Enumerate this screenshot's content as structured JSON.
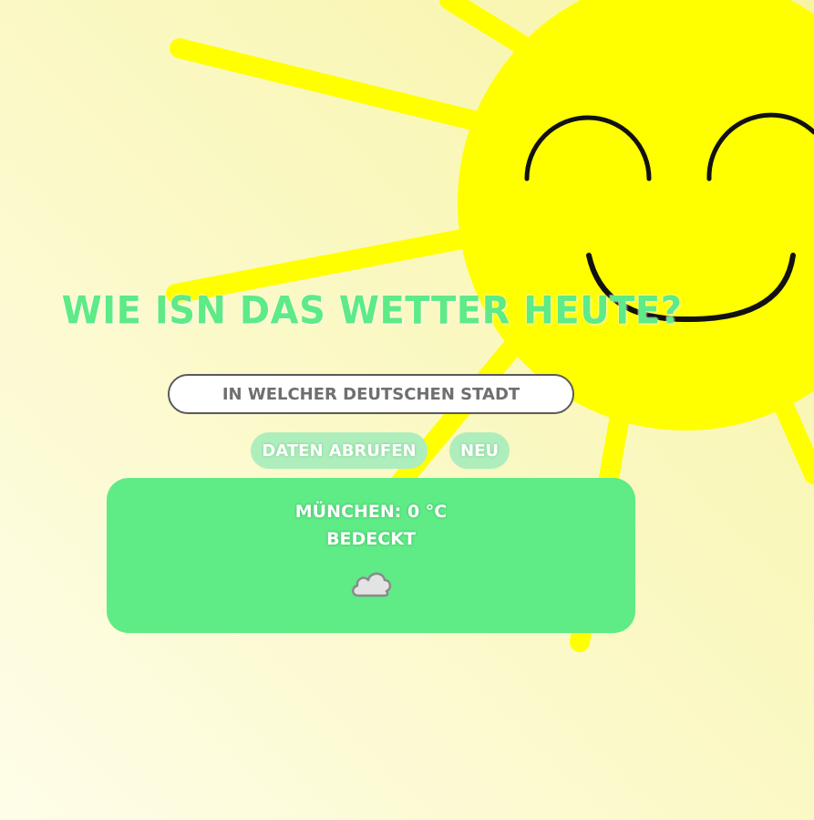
{
  "page": {
    "title": "Wie isn das Wetter heute?"
  },
  "search": {
    "placeholder": "In welcher deutschen Stadt"
  },
  "buttons": {
    "fetch_label": "Daten abrufen",
    "new_label": "Neu"
  },
  "result": {
    "city_temp": "München: 0 °C",
    "condition": "Bedeckt",
    "icon": "cloud-icon"
  },
  "colors": {
    "accent_green": "#5feb86",
    "button_green": "#aeeebc",
    "sun_yellow": "#ffff00",
    "background": "#fbf9c8"
  },
  "decoration": {
    "sun": "smiling-sun-icon"
  }
}
